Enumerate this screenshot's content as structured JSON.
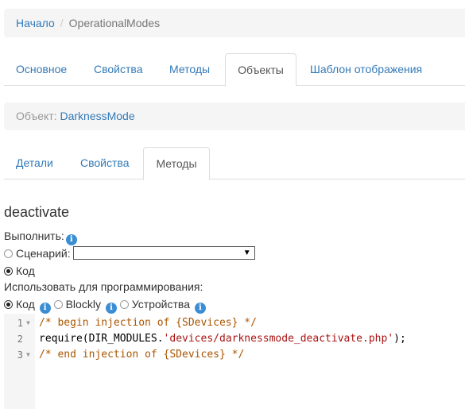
{
  "breadcrumb": {
    "home": "Начало",
    "separator": "/",
    "current": "OperationalModes"
  },
  "tabs_main": [
    "Основное",
    "Свойства",
    "Методы",
    "Объекты",
    "Шаблон отображения"
  ],
  "tabs_main_active": "Объекты",
  "object": {
    "label": "Объект:",
    "name": "DarknessMode"
  },
  "tabs_object": [
    "Детали",
    "Свойства",
    "Методы"
  ],
  "tabs_object_active": "Методы",
  "method": {
    "title": "deactivate",
    "execute_label": "Выполнить:",
    "scenario_label": "Сценарий:",
    "scenario_value": "",
    "code_label": "Код",
    "use_for_programming_label": "Использовать для программирования:",
    "mode_code": "Код",
    "mode_blockly": "Blockly",
    "mode_devices": "Устройства",
    "execute_selected": "code",
    "mode_selected": "code"
  },
  "icons": {
    "info": "info-icon",
    "dropdown": "dropdown-arrow-icon",
    "fold": "fold-arrow-icon"
  },
  "colors": {
    "link": "#337ab7",
    "info_badge": "#3b8ed4",
    "comment": "#aa5500",
    "string": "#aa1111"
  },
  "code": {
    "lines": [
      {
        "num": "1",
        "comment": "/* begin injection of {SDevices} */"
      },
      {
        "num": "2",
        "fn": "require(DIR_MODULES.",
        "str": "'devices/darknessmode_deactivate.php'",
        "tail": ");"
      },
      {
        "num": "3",
        "comment": "/* end injection of {SDevices} */"
      }
    ]
  }
}
